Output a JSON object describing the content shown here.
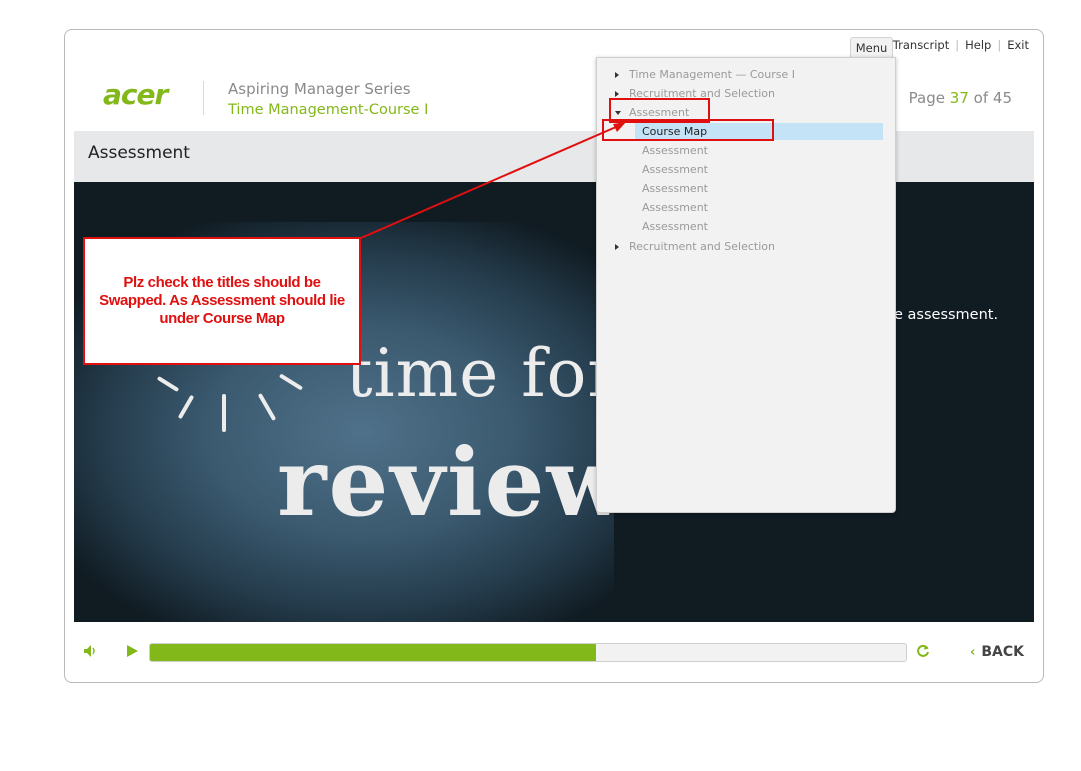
{
  "topnav": {
    "menu": "Menu",
    "transcript": "Transcript",
    "help": "Help",
    "exit": "Exit"
  },
  "header": {
    "logo": "acer",
    "series": "Aspiring Manager Series",
    "course": "Time Management-Course I",
    "page_label": "Page",
    "page_current": "37",
    "page_of": "of",
    "page_total": "45"
  },
  "slide": {
    "title": "Assessment",
    "image_text_1": "time for",
    "image_text_2": "review",
    "body_text": "e assessment."
  },
  "menu": {
    "items": [
      {
        "label": "Time Management — Course I",
        "level": 0,
        "state": "collapsed"
      },
      {
        "label": "Recruitment and Selection",
        "level": 0,
        "state": "collapsed"
      },
      {
        "label": "Assesment",
        "level": 0,
        "state": "expanded"
      },
      {
        "label": "Course Map",
        "level": 1,
        "state": "selected"
      },
      {
        "label": "Assessment",
        "level": 1
      },
      {
        "label": "Assessment",
        "level": 1
      },
      {
        "label": "Assessment",
        "level": 1
      },
      {
        "label": "Assessment",
        "level": 1
      },
      {
        "label": "Assessment",
        "level": 1
      },
      {
        "label": "Recruitment and Selection",
        "level": 0,
        "state": "collapsed"
      }
    ]
  },
  "controls": {
    "progress_percent": 59,
    "back_label": "BACK"
  },
  "annotation": {
    "text": "Plz check the titles should be Swapped. As Assessment should lie under Course Map"
  },
  "colors": {
    "accent_green": "#83b81a",
    "annotation_red": "#e01010",
    "selection_blue": "#c5e3f6"
  },
  "icons": {
    "volume": "speaker-icon",
    "play": "play-icon",
    "replay": "refresh-icon",
    "back": "chevron-left-icon"
  }
}
